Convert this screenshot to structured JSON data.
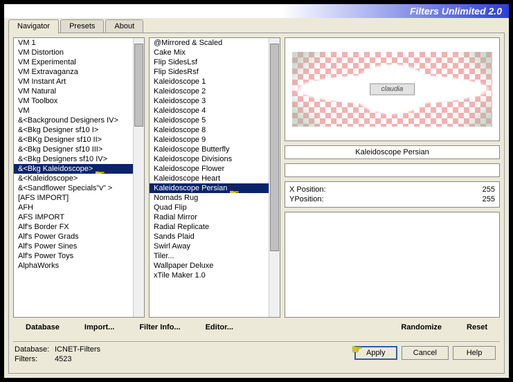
{
  "title": "Filters Unlimited 2.0",
  "tabs": [
    "Navigator",
    "Presets",
    "About"
  ],
  "activeTab": 0,
  "categories": [
    "VM 1",
    "VM Distortion",
    "VM Experimental",
    "VM Extravaganza",
    "VM Instant Art",
    "VM Natural",
    "VM Toolbox",
    "VM",
    "&<Background Designers IV>",
    "&<Bkg Designer sf10 I>",
    "&<BKg Designer sf10 II>",
    "&<Bkg Designer sf10 III>",
    "&<Bkg Designers sf10 IV>",
    "&<Bkg Kaleidoscope>",
    "&<Kaleidoscope>",
    "&<Sandflower Specials\"v\" >",
    "[AFS IMPORT]",
    "AFH",
    "AFS IMPORT",
    "Alf's Border FX",
    "Alf's Power Grads",
    "Alf's Power Sines",
    "Alf's Power Toys",
    "AlphaWorks"
  ],
  "categorySelected": 13,
  "filters": [
    "@Mirrored & Scaled",
    "Cake Mix",
    "Flip SidesLsf",
    "Flip SidesRsf",
    "Kaleidoscope 1",
    "Kaleidoscope 2",
    "Kaleidoscope 3",
    "Kaleidoscope 4",
    "Kaleidoscope 5",
    "Kaleidoscope 8",
    "Kaleidoscope 9",
    "Kaleidoscope Butterfly",
    "Kaleidoscope Divisions",
    "Kaleidoscope Flower",
    "Kaleidoscope Heart",
    "Kaleidoscope Persian",
    "Nomads Rug",
    "Quad Flip",
    "Radial Mirror",
    "Radial Replicate",
    "Sands Plaid",
    "Swirl Away",
    "Tiler...",
    "Wallpaper Deluxe",
    "xTile Maker 1.0"
  ],
  "filterSelected": 15,
  "selectedFilterName": "Kaleidoscope Persian",
  "watermark": "claudia",
  "params": [
    {
      "label": "X Position:",
      "value": "255"
    },
    {
      "label": "YPosition:",
      "value": "255"
    }
  ],
  "buttons": {
    "database": "Database",
    "import": "Import...",
    "filterInfo": "Filter Info...",
    "editor": "Editor...",
    "randomize": "Randomize",
    "reset": "Reset",
    "apply": "Apply",
    "cancel": "Cancel",
    "help": "Help"
  },
  "status": {
    "dbLabel": "Database:",
    "dbValue": "ICNET-Filters",
    "filtersLabel": "Filters:",
    "filtersValue": "4523"
  }
}
